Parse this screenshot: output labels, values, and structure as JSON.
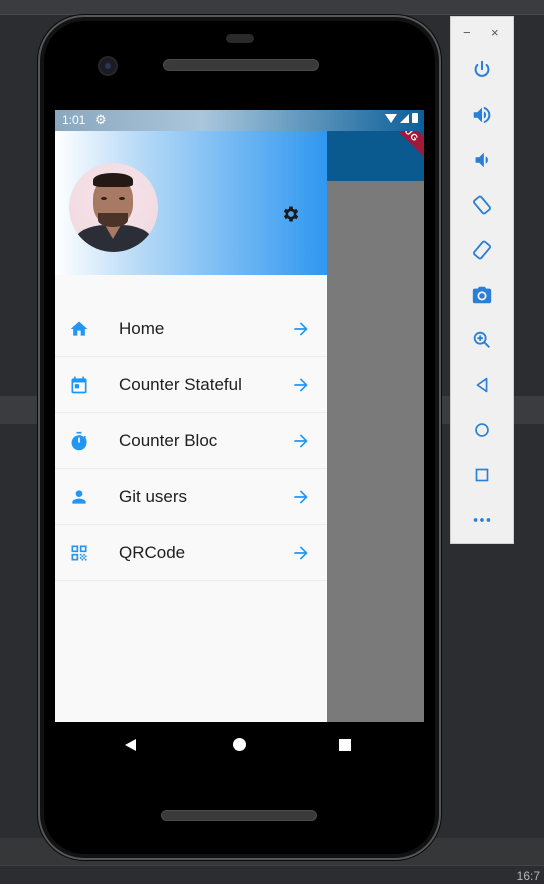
{
  "ide": {
    "clock": "16:7"
  },
  "status_bar": {
    "time": "1:01",
    "debug_badge": "DEBUG"
  },
  "drawer": {
    "settings_icon": "gear-icon",
    "items": [
      {
        "label": "Home",
        "icon": "home-icon"
      },
      {
        "label": "Counter Stateful",
        "icon": "calendar-icon"
      },
      {
        "label": "Counter Bloc",
        "icon": "timer-icon"
      },
      {
        "label": "Git users",
        "icon": "person-icon"
      },
      {
        "label": "QRCode",
        "icon": "qr-code-icon"
      }
    ]
  },
  "emulator_toolbar": {
    "window_controls": [
      "−",
      "×"
    ],
    "buttons": [
      "power-icon",
      "volume-up-icon",
      "volume-down-icon",
      "rotate-left-icon",
      "rotate-right-icon",
      "camera-icon",
      "zoom-icon",
      "back-icon",
      "home-icon",
      "overview-icon",
      "more-icon"
    ],
    "more_label": "•••"
  },
  "colors": {
    "accent": "#2196F3",
    "app_bar": "#0a5a8f",
    "scrim": "#7a7a7a"
  }
}
